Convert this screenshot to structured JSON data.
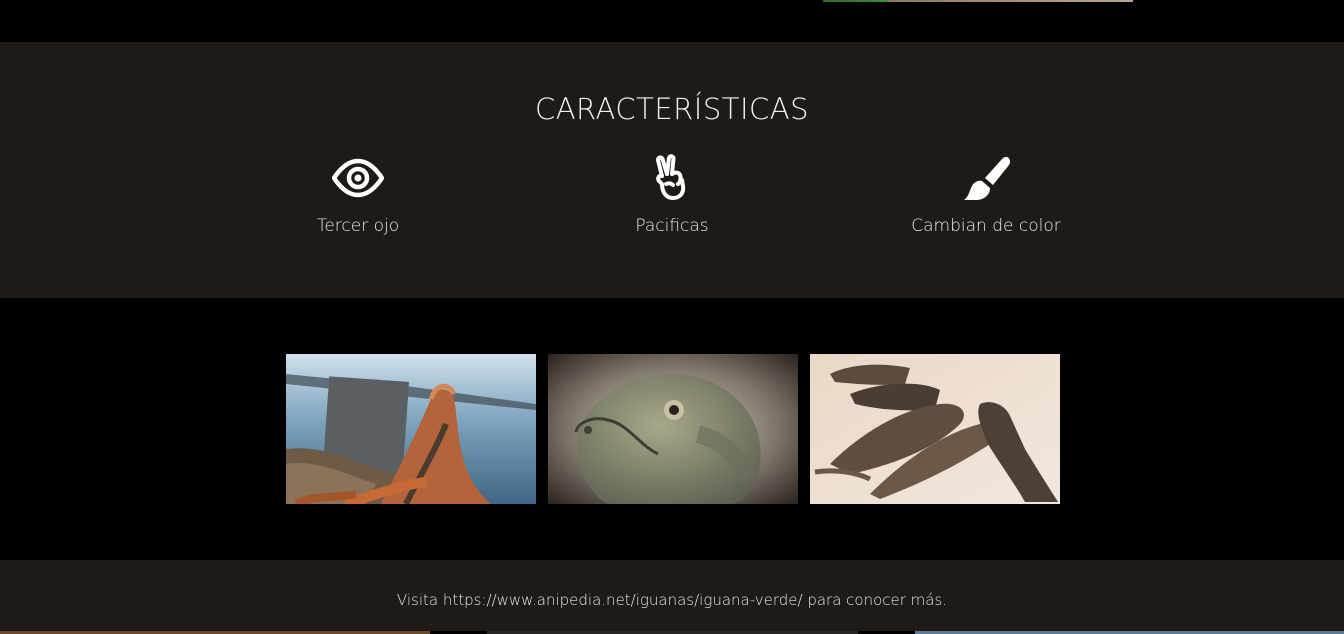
{
  "features": {
    "title": "CARACTERÍSTICAS",
    "items": [
      {
        "icon": "eye-icon",
        "label": "Tercer ojo"
      },
      {
        "icon": "peace-hand-icon",
        "label": "Pacificas"
      },
      {
        "icon": "paint-brush-icon",
        "label": "Cambian de color"
      }
    ]
  },
  "gallery": {
    "images": [
      {
        "name": "iguana-on-beach-photo"
      },
      {
        "name": "iguana-portrait-photo"
      },
      {
        "name": "iguanas-group-photo"
      }
    ]
  },
  "footer": {
    "text": "Visita https://www.anipedia.net/iguanas/iguana-verde/ para conocer más."
  },
  "colors": {
    "section_bg": "#1f1a16",
    "page_bg": "#000000",
    "text": "#f2eee8"
  }
}
